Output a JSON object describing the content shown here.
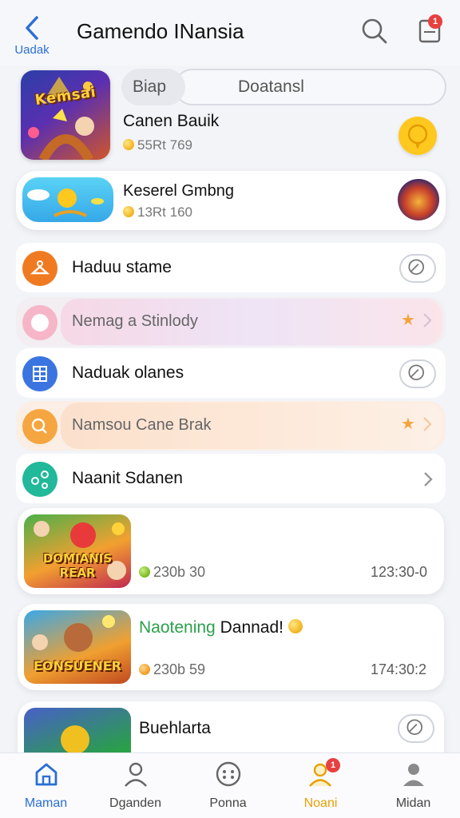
{
  "header": {
    "back_label": "Uadak",
    "title": "Gamendo INansia",
    "notification_count": "1",
    "icons": [
      "chevron-left-icon",
      "search-icon",
      "clipboard-icon"
    ]
  },
  "featured": {
    "thumb_text": "Kemsai",
    "pill_left": "Biap",
    "pill_right": "Doatansl",
    "name": "Canen Bauik",
    "meta": "55Rt 769"
  },
  "card2": {
    "name": "Keserel Gmbng",
    "meta": "13Rt 160"
  },
  "list": {
    "items": [
      {
        "label": "Haduu stame",
        "icon_color": "#f07a22",
        "icon": "hanger-icon",
        "variant": "plain"
      },
      {
        "label": "Nemag a Stinlody",
        "icon_color": "#f6b6c8",
        "icon": "chat-bubble-icon",
        "variant": "highlight-pink"
      },
      {
        "label": "Naduak olanes",
        "icon_color": "#3a74e0",
        "icon": "grid-list-icon",
        "variant": "plain"
      },
      {
        "label": "Namsou Cane Brak",
        "icon_color": "#f5a640",
        "icon": "search-icon",
        "variant": "highlight-orange"
      },
      {
        "label": "Naanit Sdanen",
        "icon_color": "#22b89a",
        "icon": "share-icon",
        "variant": "plain"
      }
    ]
  },
  "game_cards": [
    {
      "thumb_text": "DOMIANIS REAR",
      "coin_value": "230b 30",
      "time": "123:30-0"
    },
    {
      "thumb_text": "EONSUENER",
      "title_green": "Naotening",
      "title_rest": "Dannad!",
      "coin_value": "230b 59",
      "time": "174:30:2"
    }
  ],
  "partial_card": {
    "title": "Buehlarta"
  },
  "bottom_nav": {
    "items": [
      {
        "label": "Maman",
        "icon": "home-icon",
        "state": "active"
      },
      {
        "label": "Dganden",
        "icon": "user-outline-icon",
        "state": "normal"
      },
      {
        "label": "Ponna",
        "icon": "gamepad-icon",
        "state": "normal"
      },
      {
        "label": "Noani",
        "icon": "people-alert-icon",
        "state": "alert",
        "badge": "1"
      },
      {
        "label": "Midan",
        "icon": "profile-icon",
        "state": "normal"
      }
    ]
  },
  "colors": {
    "accent": "#2b6fd6",
    "alert": "#e84040",
    "gold": "#ffc81e",
    "green_title": "#2aa14a"
  }
}
